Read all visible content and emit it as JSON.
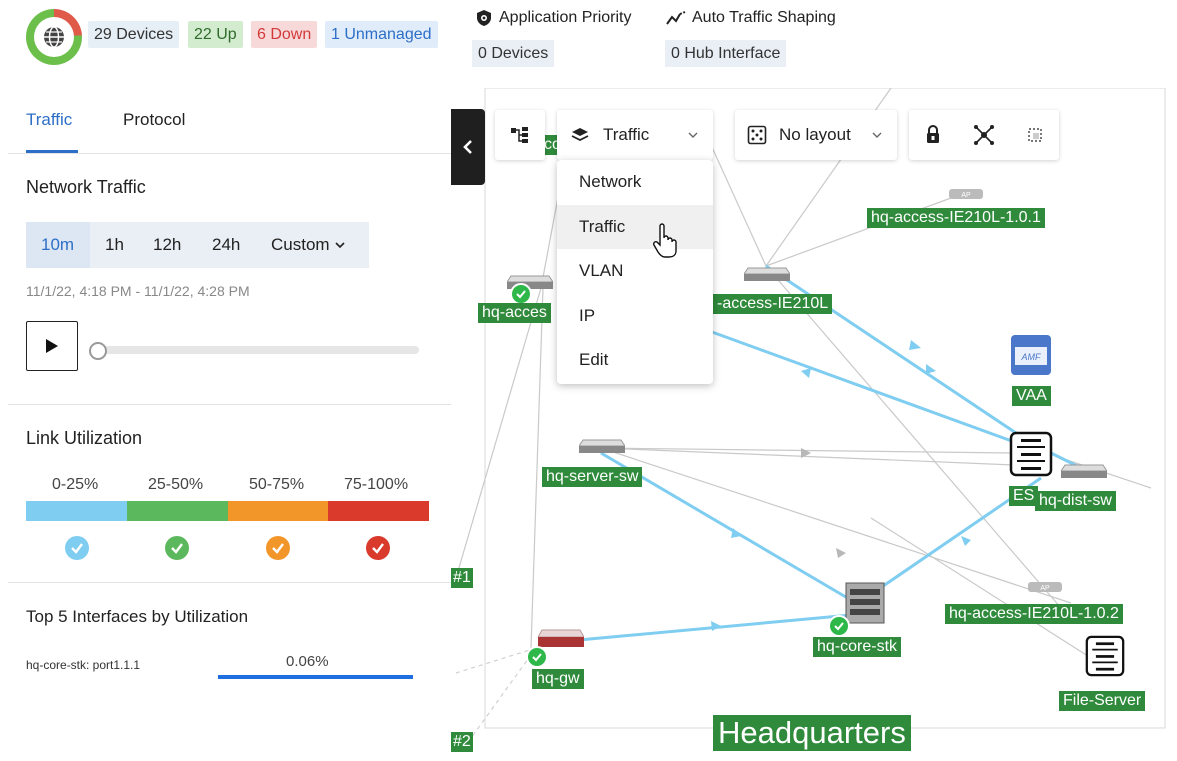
{
  "header": {
    "devices": "29 Devices",
    "up": "22 Up",
    "down": "6 Down",
    "unmanaged": "1 Unmanaged",
    "app_priority_label": "Application Priority",
    "app_priority_value": "0 Devices",
    "ats_label": "Auto Traffic Shaping",
    "ats_value": "0 Hub Interface"
  },
  "left": {
    "tabs": [
      "Traffic",
      "Protocol"
    ],
    "network_traffic_title": "Network Traffic",
    "ranges": [
      "10m",
      "1h",
      "12h",
      "24h",
      "Custom"
    ],
    "selected_range": "10m",
    "time_window": "11/1/22, 4:18 PM - 11/1/22, 4:28 PM",
    "link_util_title": "Link Utilization",
    "legend": [
      {
        "label": "0-25%",
        "color": "#7fcdf0"
      },
      {
        "label": "25-50%",
        "color": "#5cb85c"
      },
      {
        "label": "50-75%",
        "color": "#f3962a"
      },
      {
        "label": "75-100%",
        "color": "#d93a2b"
      }
    ],
    "top5_title": "Top 5 Interfaces by Utilization",
    "top5": [
      {
        "name": "hq-core-stk: port1.1.1",
        "value": "0.06%"
      }
    ]
  },
  "toolbar": {
    "view_label": "Traffic",
    "layout_label": "No layout"
  },
  "dropdown": {
    "items": [
      "Network",
      "Traffic",
      "VLAN",
      "IP",
      "Edit"
    ],
    "hovered": "Traffic"
  },
  "map": {
    "nodes": {
      "access_top": "hq-access-IE210L-1.0.1",
      "access_left": "hq-acces",
      "access_mid": "-access-IE210L",
      "vaa": "VAA",
      "server_sw": "hq-server-sw",
      "es": "ES",
      "dist_sw": "hq-dist-sw",
      "access_102": "hq-access-IE210L-1.0.2",
      "core_stk": "hq-core-stk",
      "gw": "hq-gw",
      "file_server": "File-Server",
      "partial_co": "co",
      "edge1": "#1",
      "edge2": "#2"
    },
    "site_label": "Headquarters"
  },
  "colors": {
    "accent": "#2d6fc7",
    "node_label_bg": "#2f8a3b",
    "link_blue": "#7fcdf0"
  }
}
